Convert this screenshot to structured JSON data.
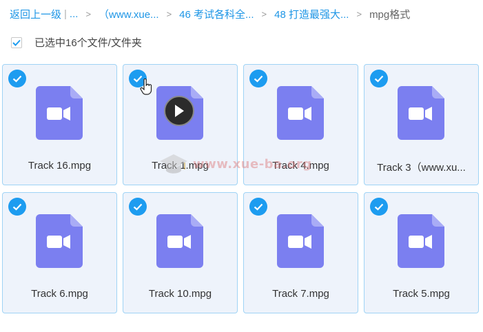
{
  "breadcrumb": {
    "back_label": "返回上一级",
    "divider": "|",
    "ellipsis": "...",
    "crumbs": [
      {
        "label": "（www.xue..."
      },
      {
        "label": "46 考试各科全..."
      },
      {
        "label": "48 打造最强大..."
      }
    ],
    "separator": ">",
    "current": "mpg格式"
  },
  "selection": {
    "checked": true,
    "label": "已选中16个文件/文件夹"
  },
  "files": [
    {
      "name": "Track 16.mpg",
      "selected": true,
      "icon": "video-file-icon"
    },
    {
      "name": "Track 1.mpg",
      "selected": true,
      "icon": "video-file-icon",
      "hover_play": true
    },
    {
      "name": "Track 4.mpg",
      "selected": true,
      "icon": "video-file-icon"
    },
    {
      "name": "Track 3（www.xu...",
      "selected": true,
      "icon": "video-file-icon"
    },
    {
      "name": "Track 6.mpg",
      "selected": true,
      "icon": "video-file-icon"
    },
    {
      "name": "Track 10.mpg",
      "selected": true,
      "icon": "video-file-icon"
    },
    {
      "name": "Track 7.mpg",
      "selected": true,
      "icon": "video-file-icon"
    },
    {
      "name": "Track 5.mpg",
      "selected": true,
      "icon": "video-file-icon"
    }
  ],
  "watermark": {
    "text": "www.xue-ba.org"
  },
  "colors": {
    "accent": "#1d9cf0",
    "link": "#1e96e6",
    "file_icon": "#7b7ff0",
    "card_bg": "#eef3fb",
    "card_border": "#9fd3f5"
  }
}
